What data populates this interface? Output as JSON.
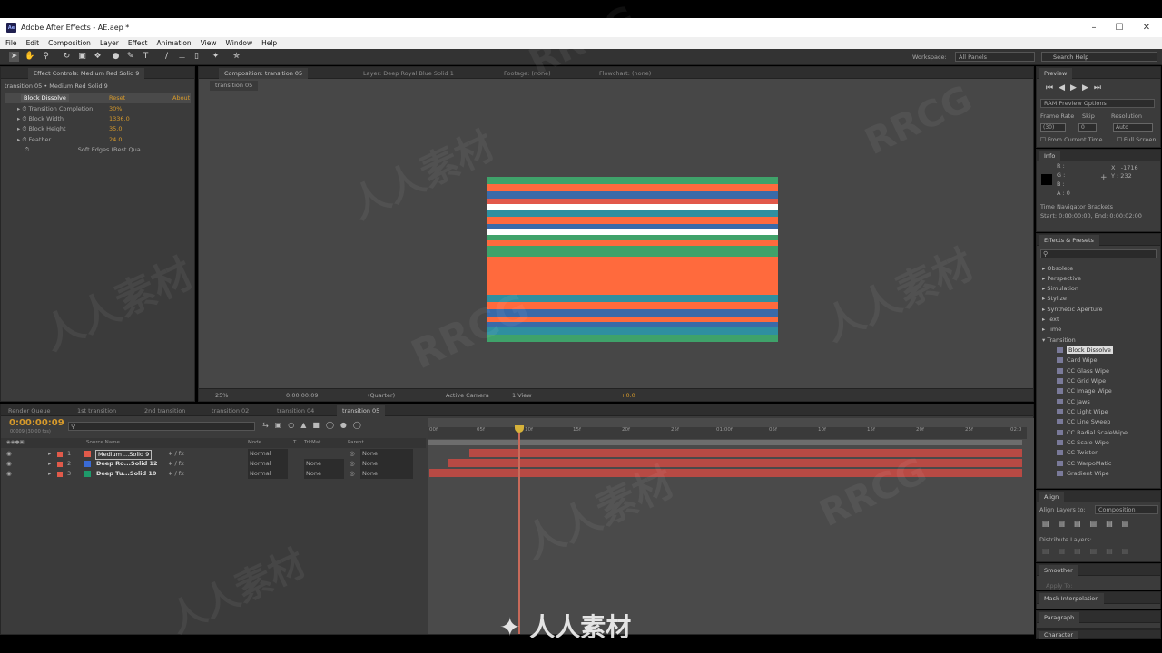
{
  "window": {
    "title": "Adobe After Effects - AE.aep *",
    "app_icon": "Ae"
  },
  "menu": [
    "File",
    "Edit",
    "Composition",
    "Layer",
    "Effect",
    "Animation",
    "View",
    "Window",
    "Help"
  ],
  "toolbar": {
    "workspace_label": "Workspace:",
    "workspace_value": "All Panels",
    "search_placeholder": "Search Help"
  },
  "effect_controls": {
    "tab": "Effect Controls: Medium Red Solid 9",
    "breadcrumb": "transition 05 • Medium Red Solid 9",
    "effect_name": "Block Dissolve",
    "reset": "Reset",
    "about": "About",
    "props": [
      {
        "name": "Transition Completion",
        "value": "30%"
      },
      {
        "name": "Block Width",
        "value": "1336.0"
      },
      {
        "name": "Block Height",
        "value": "35.0"
      },
      {
        "name": "Feather",
        "value": "24.0"
      }
    ],
    "soft_edges": "Soft Edges (Best Qua"
  },
  "composition": {
    "tab": "Composition: transition 05",
    "layer_tab": "Layer: Deep Royal Blue Solid 1",
    "footage_tab": "Footage: (none)",
    "flowchart_tab": "Flowchart: (none)",
    "sub_tab": "transition 05",
    "zoom": "25%",
    "timecode": "0:00:00:09",
    "resolution": "(Quarter)",
    "camera": "Active Camera",
    "view": "1 View",
    "exposure": "+0.0"
  },
  "preview": {
    "title": "Preview",
    "ram_options": "RAM Preview Options",
    "frame_rate_label": "Frame Rate",
    "skip_label": "Skip",
    "resolution_label": "Resolution",
    "frame_rate": "(30)",
    "skip": "0",
    "resolution": "Auto",
    "from_current": "From Current Time",
    "full_screen": "Full Screen"
  },
  "info": {
    "title": "Info",
    "r": "R :",
    "g": "G :",
    "b": "B :",
    "a": "A : 0",
    "x": "X : -1716",
    "y": "Y : 232",
    "nav_label": "Time Navigator Brackets",
    "nav_range": "Start: 0:00:00:00, End: 0:00:02:00"
  },
  "effects_presets": {
    "title": "Effects & Presets",
    "categories": [
      "Obsolete",
      "Perspective",
      "Simulation",
      "Stylize",
      "Synthetic Aperture",
      "Text",
      "Time",
      "Transition"
    ],
    "transition_items": [
      "Block Dissolve",
      "Card Wipe",
      "CC Glass Wipe",
      "CC Grid Wipe",
      "CC Image Wipe",
      "CC Jaws",
      "CC Light Wipe",
      "CC Line Sweep",
      "CC Radial ScaleWipe",
      "CC Scale Wipe",
      "CC Twister",
      "CC WarpoMatic",
      "Gradient Wipe"
    ]
  },
  "align": {
    "title": "Align",
    "align_to_label": "Align Layers to:",
    "align_to_value": "Composition",
    "distribute_label": "Distribute Layers:"
  },
  "smoother": {
    "title": "Smoother",
    "apply_to": "Apply To:"
  },
  "mask_interp": {
    "title": "Mask Interpolation"
  },
  "paragraph": {
    "title": "Paragraph"
  },
  "character": {
    "title": "Character"
  },
  "timeline": {
    "tabs": [
      "Render Queue",
      "1st transition",
      "2nd transition",
      "transition 02",
      "transition 04",
      "transition 05"
    ],
    "timecode": "0:00:00:09",
    "fps": "00009 (30.00 fps)",
    "columns": {
      "source_name": "Source Name",
      "mode": "Mode",
      "t": "T",
      "trkmat": "TrkMat",
      "parent": "Parent"
    },
    "layers": [
      {
        "num": "1",
        "name": "Medium ...Solid 9",
        "mode": "Normal",
        "trkmat": "",
        "parent": "None",
        "color": "#e05a4a"
      },
      {
        "num": "2",
        "name": "Deep Ro...Solid 12",
        "mode": "Normal",
        "trkmat": "None",
        "parent": "None",
        "color": "#3a6ad4"
      },
      {
        "num": "3",
        "name": "Deep Tu...Solid 10",
        "mode": "Normal",
        "trkmat": "None",
        "parent": "None",
        "color": "#1e9a6a"
      }
    ],
    "ruler": [
      "00f",
      "05f",
      "10f",
      "15f",
      "20f",
      "25f",
      "01:00f",
      "05f",
      "10f",
      "15f",
      "20f",
      "25f",
      "02:0"
    ]
  },
  "watermark": {
    "text": "RRCG",
    "cn_text": "人人素材"
  },
  "colors": {
    "accent_orange": "#d79a2b",
    "panel_bg": "#3b3b3b",
    "layer_bar": "#b84a44",
    "cti": "#d6b23a"
  }
}
